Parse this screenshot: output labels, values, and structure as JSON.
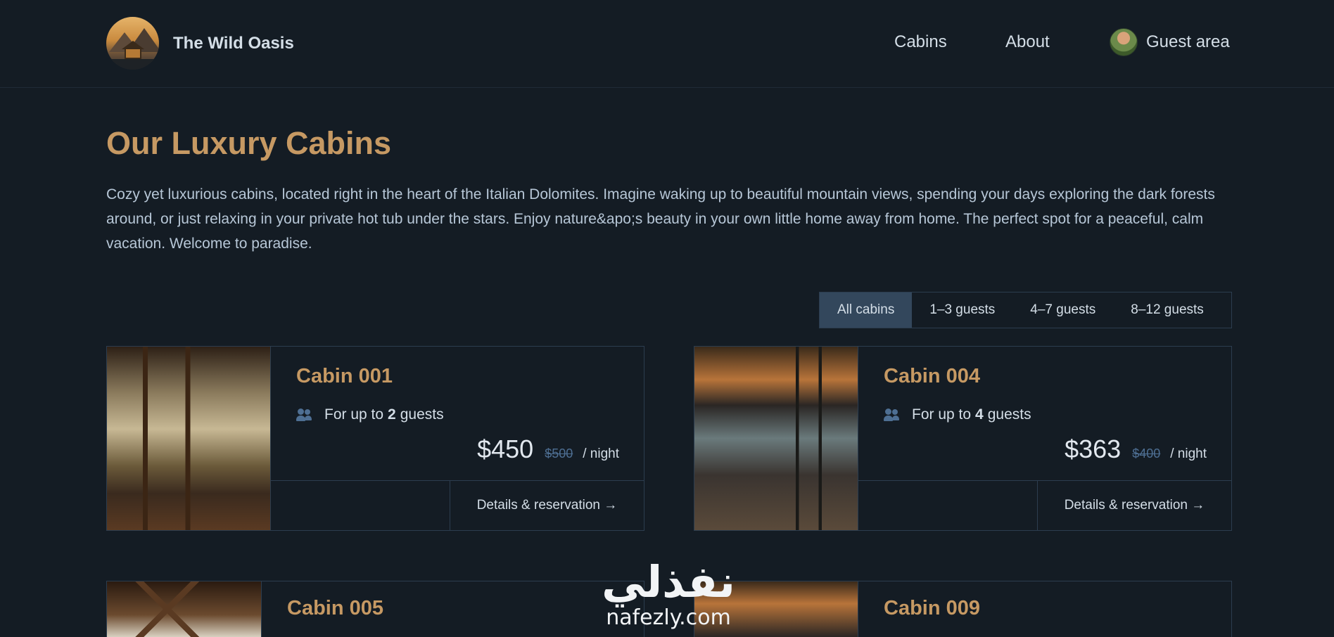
{
  "header": {
    "logo_text": "The Wild Oasis",
    "nav": {
      "cabins": "Cabins",
      "about": "About",
      "guest_area": "Guest area"
    }
  },
  "main": {
    "title": "Our Luxury Cabins",
    "intro": "Cozy yet luxurious cabins, located right in the heart of the Italian Dolomites. Imagine waking up to beautiful mountain views, spending your days exploring the dark forests around, or just relaxing in your private hot tub under the stars. Enjoy nature&apo;s beauty in your own little home away from home. The perfect spot for a peaceful, calm vacation. Welcome to paradise."
  },
  "filter": {
    "options": [
      "All cabins",
      "1–3 guests",
      "4–7 guests",
      "8–12 guests"
    ],
    "active": "All cabins"
  },
  "cabins": [
    {
      "name": "Cabin 001",
      "guests_prefix": "For up to",
      "guests": "2",
      "guests_suffix": "guests",
      "price": "$450",
      "old_price": "$500",
      "per": "/ night",
      "link": "Details & reservation →"
    },
    {
      "name": "Cabin 004",
      "guests_prefix": "For up to",
      "guests": "4",
      "guests_suffix": "guests",
      "price": "$363",
      "old_price": "$400",
      "per": "/ night",
      "link": "Details & reservation →"
    },
    {
      "name": "Cabin 005"
    },
    {
      "name": "Cabin 009"
    }
  ],
  "watermark": {
    "arabic": "نفذلي",
    "latin": "nafezly.com"
  },
  "colors": {
    "accent": "#c69963",
    "background": "#141c24",
    "border": "#2c3d4f",
    "active_filter": "#33475c"
  }
}
